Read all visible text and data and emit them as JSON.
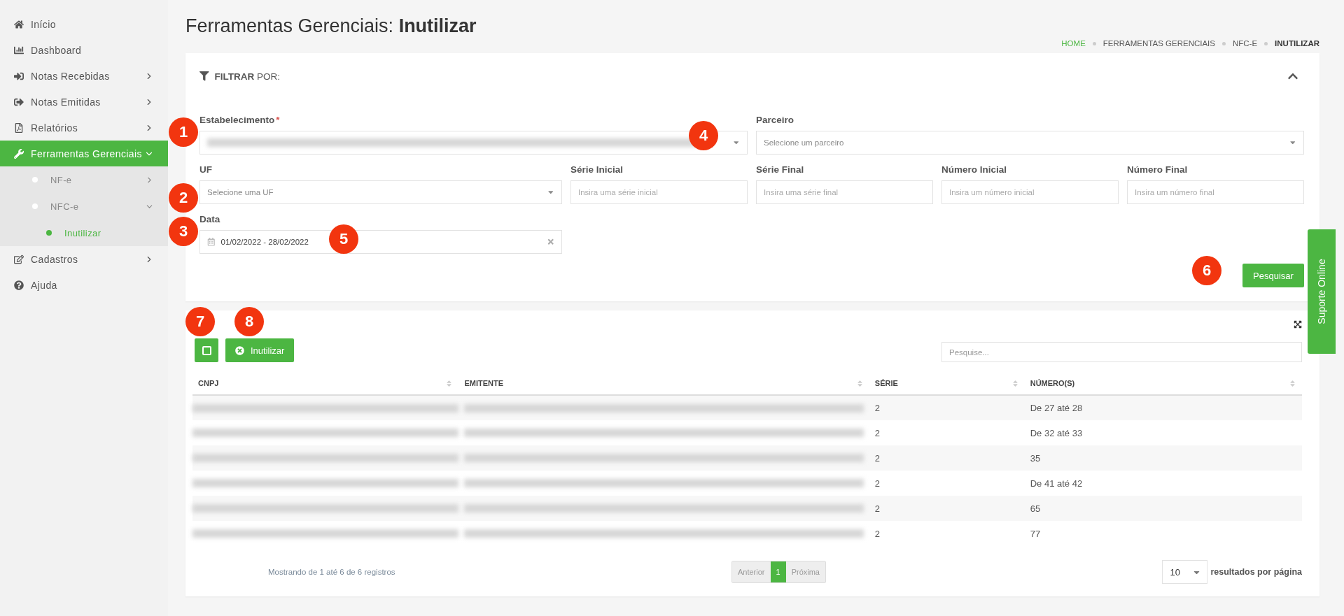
{
  "sidebar": {
    "items": [
      {
        "label": "Início",
        "selected": false
      },
      {
        "label": "Dashboard",
        "selected": false
      },
      {
        "label": "Notas Recebidas",
        "selected": false,
        "expanded": false
      },
      {
        "label": "Notas Emitidas",
        "selected": false,
        "expanded": false
      },
      {
        "label": "Relatórios",
        "selected": false,
        "expanded": false
      },
      {
        "label": "Ferramentas Gerenciais",
        "selected": true,
        "expanded": true,
        "children": [
          {
            "label": "NF-e",
            "selected": false,
            "expanded": false
          },
          {
            "label": "NFC-e",
            "selected": false,
            "expanded": true,
            "children": [
              {
                "label": "Inutilizar",
                "selected": true
              }
            ]
          }
        ]
      },
      {
        "label": "Cadastros",
        "selected": false,
        "expanded": false
      },
      {
        "label": "Ajuda",
        "selected": false
      }
    ]
  },
  "page_title": {
    "section": "Ferramentas Gerenciais:",
    "page": "Inutilizar"
  },
  "breadcrumb": [
    {
      "label": "HOME",
      "kind": "link"
    },
    {
      "label": "FERRAMENTAS GERENCIAIS",
      "kind": "text"
    },
    {
      "label": "NFC-E",
      "kind": "text"
    },
    {
      "label": "INUTILIZAR",
      "kind": "current"
    }
  ],
  "filter": {
    "title_bold": "FILTRAR",
    "title_rest": "POR:",
    "expanded": true,
    "required_mark": "*",
    "fields": [
      {
        "label": "Estabelecimento",
        "required": true,
        "kind": "blurred-select"
      },
      {
        "label": "Parceiro",
        "required": false,
        "kind": "select",
        "placeholder": "Selecione um parceiro"
      },
      {
        "label": "UF",
        "required": false,
        "kind": "select",
        "placeholder": "Selecione uma UF"
      },
      {
        "label": "Série Inicial",
        "required": false,
        "kind": "input",
        "placeholder": "Insira uma série inicial"
      },
      {
        "label": "Série Final",
        "required": false,
        "kind": "input",
        "placeholder": "Insira uma série final"
      },
      {
        "label": "Número Inicial",
        "required": false,
        "kind": "input",
        "placeholder": "Insira um número inicial"
      },
      {
        "label": "Número Final",
        "required": false,
        "kind": "input",
        "placeholder": "Insira um número final"
      },
      {
        "label": "Data",
        "required": false,
        "kind": "date",
        "value": "01/02/2022 - 28/02/2022"
      }
    ],
    "search_button": "Pesquisar"
  },
  "results": {
    "select_all": {
      "checked": false
    },
    "action_button": "Inutilizar",
    "search": {
      "placeholder": "Pesquise..."
    },
    "table": {
      "columns": [
        "CNPJ",
        "EMITENTE",
        "SÉRIE",
        "NÚMERO(S)"
      ],
      "rows": [
        {
          "serie": "2",
          "numeros": "De 27 até 28"
        },
        {
          "serie": "2",
          "numeros": "De 32 até 33"
        },
        {
          "serie": "2",
          "numeros": "35"
        },
        {
          "serie": "2",
          "numeros": "De 41 até 42"
        },
        {
          "serie": "2",
          "numeros": "65"
        },
        {
          "serie": "2",
          "numeros": "77"
        }
      ]
    },
    "info": "Mostrando de 1 até 6 de 6 registros",
    "pagination": [
      {
        "label": "Anterior",
        "selected": false,
        "disabled": true
      },
      {
        "label": "1",
        "selected": true,
        "disabled": false
      },
      {
        "label": "Próxima",
        "selected": false,
        "disabled": true
      }
    ],
    "page_size": {
      "value": "10",
      "label": "resultados por página"
    }
  },
  "support_tab": "Suporte Online",
  "callouts": [
    "1",
    "2",
    "3",
    "4",
    "5",
    "6",
    "7",
    "8"
  ]
}
